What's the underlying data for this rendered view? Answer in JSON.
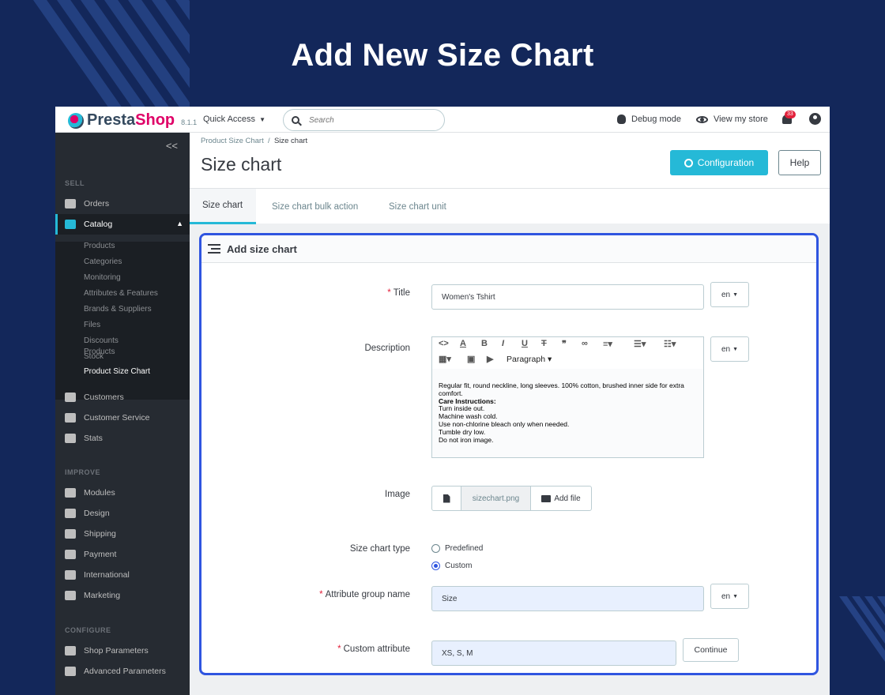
{
  "headline": "Add New Size Chart",
  "topbar": {
    "logo_presta": "Presta",
    "logo_shop": "Shop",
    "version": "8.1.1",
    "quick_access": "Quick Access",
    "search_placeholder": "Search",
    "debug_mode": "Debug mode",
    "view_store": "View my store",
    "notification_count": "33"
  },
  "sidebar": {
    "collapse_glyph": "<<",
    "sections": {
      "sell": "SELL",
      "improve": "IMPROVE",
      "configure": "CONFIGURE"
    },
    "sell_items": [
      "Orders",
      "Catalog"
    ],
    "catalog_sub": [
      "Products",
      "Categories",
      "Monitoring",
      "Attributes & Features",
      "Brands & Suppliers",
      "Files",
      "Discounts",
      "Stock",
      "Product Size Chart"
    ],
    "more_sell": [
      "Customers",
      "Customer Service",
      "Stats"
    ],
    "improve_items": [
      "Modules",
      "Design",
      "Shipping",
      "Payment",
      "International",
      "Marketing"
    ],
    "configure_items": [
      "Shop Parameters",
      "Advanced Parameters"
    ]
  },
  "header": {
    "breadcrumb_parent": "Product Size Chart",
    "breadcrumb_sep": "/",
    "breadcrumb_current": "Size chart",
    "page_title": "Size chart",
    "configuration_label": "Configuration",
    "help_label": "Help"
  },
  "tabs": [
    "Size chart",
    "Size chart bulk action",
    "Size chart unit"
  ],
  "form": {
    "card_title": "Add size chart",
    "required_mark": "*",
    "title_label": "Title",
    "title_value": "Women's Tshirt",
    "lang": "en",
    "description_label": "Description",
    "toolbar_paragraph": "Paragraph",
    "description": {
      "intro": "Regular fit, round neckline, long sleeves. 100% cotton, brushed inner side for extra comfort.",
      "heading": "Care Instructions:",
      "lines": [
        "Turn inside out.",
        "Machine wash cold.",
        "Use non-chlorine bleach only when needed.",
        "Tumble dry low.",
        "Do not iron image."
      ]
    },
    "image_label": "Image",
    "file_name": "sizechart.png",
    "add_file": "Add file",
    "size_chart_type_label": "Size chart type",
    "type_options": [
      "Predefined",
      "Custom"
    ],
    "selected_type": "Custom",
    "attribute_group_label": "Attribute group name",
    "attribute_group_value": "Size",
    "custom_attribute_label": "Custom attribute",
    "custom_attribute_value": "XS, S, M",
    "continue_label": "Continue"
  },
  "colors": {
    "background": "#13275a",
    "accent": "#25b9d7",
    "highlight": "#2f55e0",
    "brand": "#df0067"
  }
}
